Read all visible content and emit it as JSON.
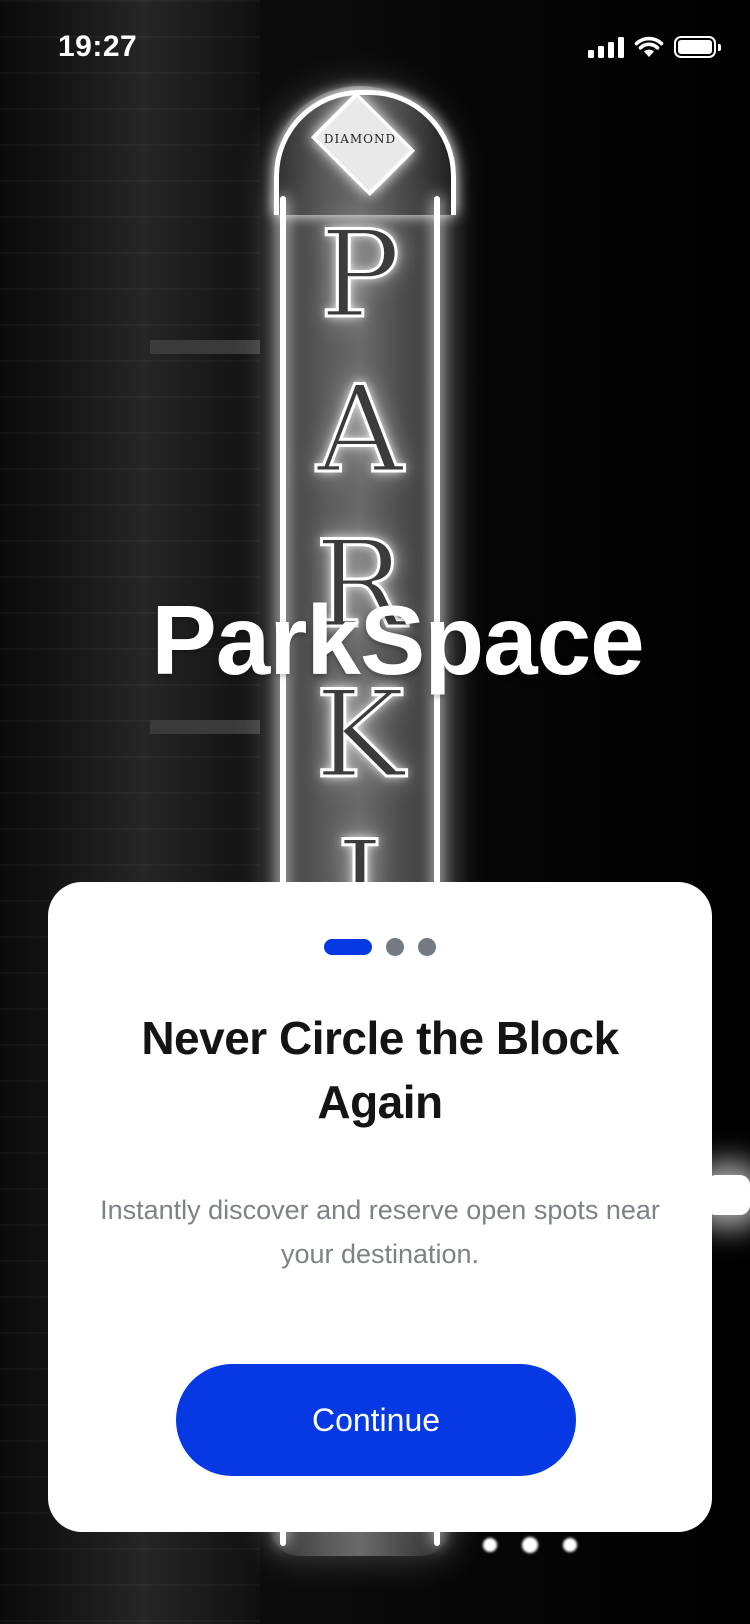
{
  "status_bar": {
    "time": "19:27",
    "icons": [
      "cellular-signal-icon",
      "wifi-icon",
      "battery-icon"
    ]
  },
  "background": {
    "description_icon": "neon-parking-sign-photo",
    "sign_letters": [
      "P",
      "A",
      "R",
      "K",
      "I"
    ],
    "sign_badge": "DIAMOND"
  },
  "brand": {
    "name": "ParkSpace"
  },
  "onboarding": {
    "page_indicator": {
      "total": 3,
      "active": 0
    },
    "headline": "Never Circle the Block Again",
    "subtitle": "Instantly discover and reserve open spots near your destination.",
    "continue_label": "Continue"
  },
  "colors": {
    "accent": "#0638e4",
    "card": "#ffffff",
    "headline": "#141414",
    "subtitle": "#7d8288",
    "inactive_dot": "#747a80"
  }
}
